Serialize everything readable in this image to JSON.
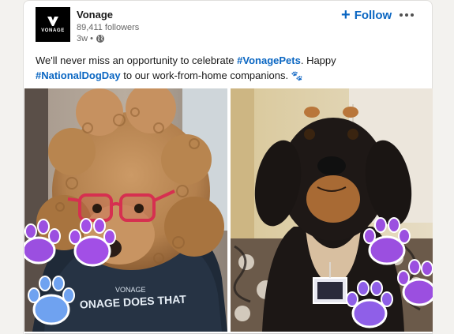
{
  "post": {
    "author": {
      "name": "Vonage",
      "followers": "89,411 followers",
      "time": "3w",
      "visibility_icon": "globe-icon",
      "logo_text": "VONAGE"
    },
    "follow_label": "Follow",
    "more_icon": "more-horizontal-icon",
    "text": {
      "part1": "We'll never miss an opportunity to celebrate ",
      "hashtag1": "#VonagePets",
      "part2": ". Happy ",
      "hashtag2": "#NationalDogDay",
      "part3": " to our work-from-home companions. ",
      "emoji": "🐾"
    },
    "images": [
      {
        "name": "poodle-with-glasses-photo",
        "shirt_text": "ONAGE DOES THAT",
        "shirt_brand": "VONAGE"
      },
      {
        "name": "black-tan-dog-photo"
      }
    ]
  },
  "colors": {
    "link": "#0a66c2",
    "text": "#191919",
    "muted": "#666666",
    "paw_purple": "#9b4fe0",
    "paw_blue": "#6fa2f0"
  }
}
